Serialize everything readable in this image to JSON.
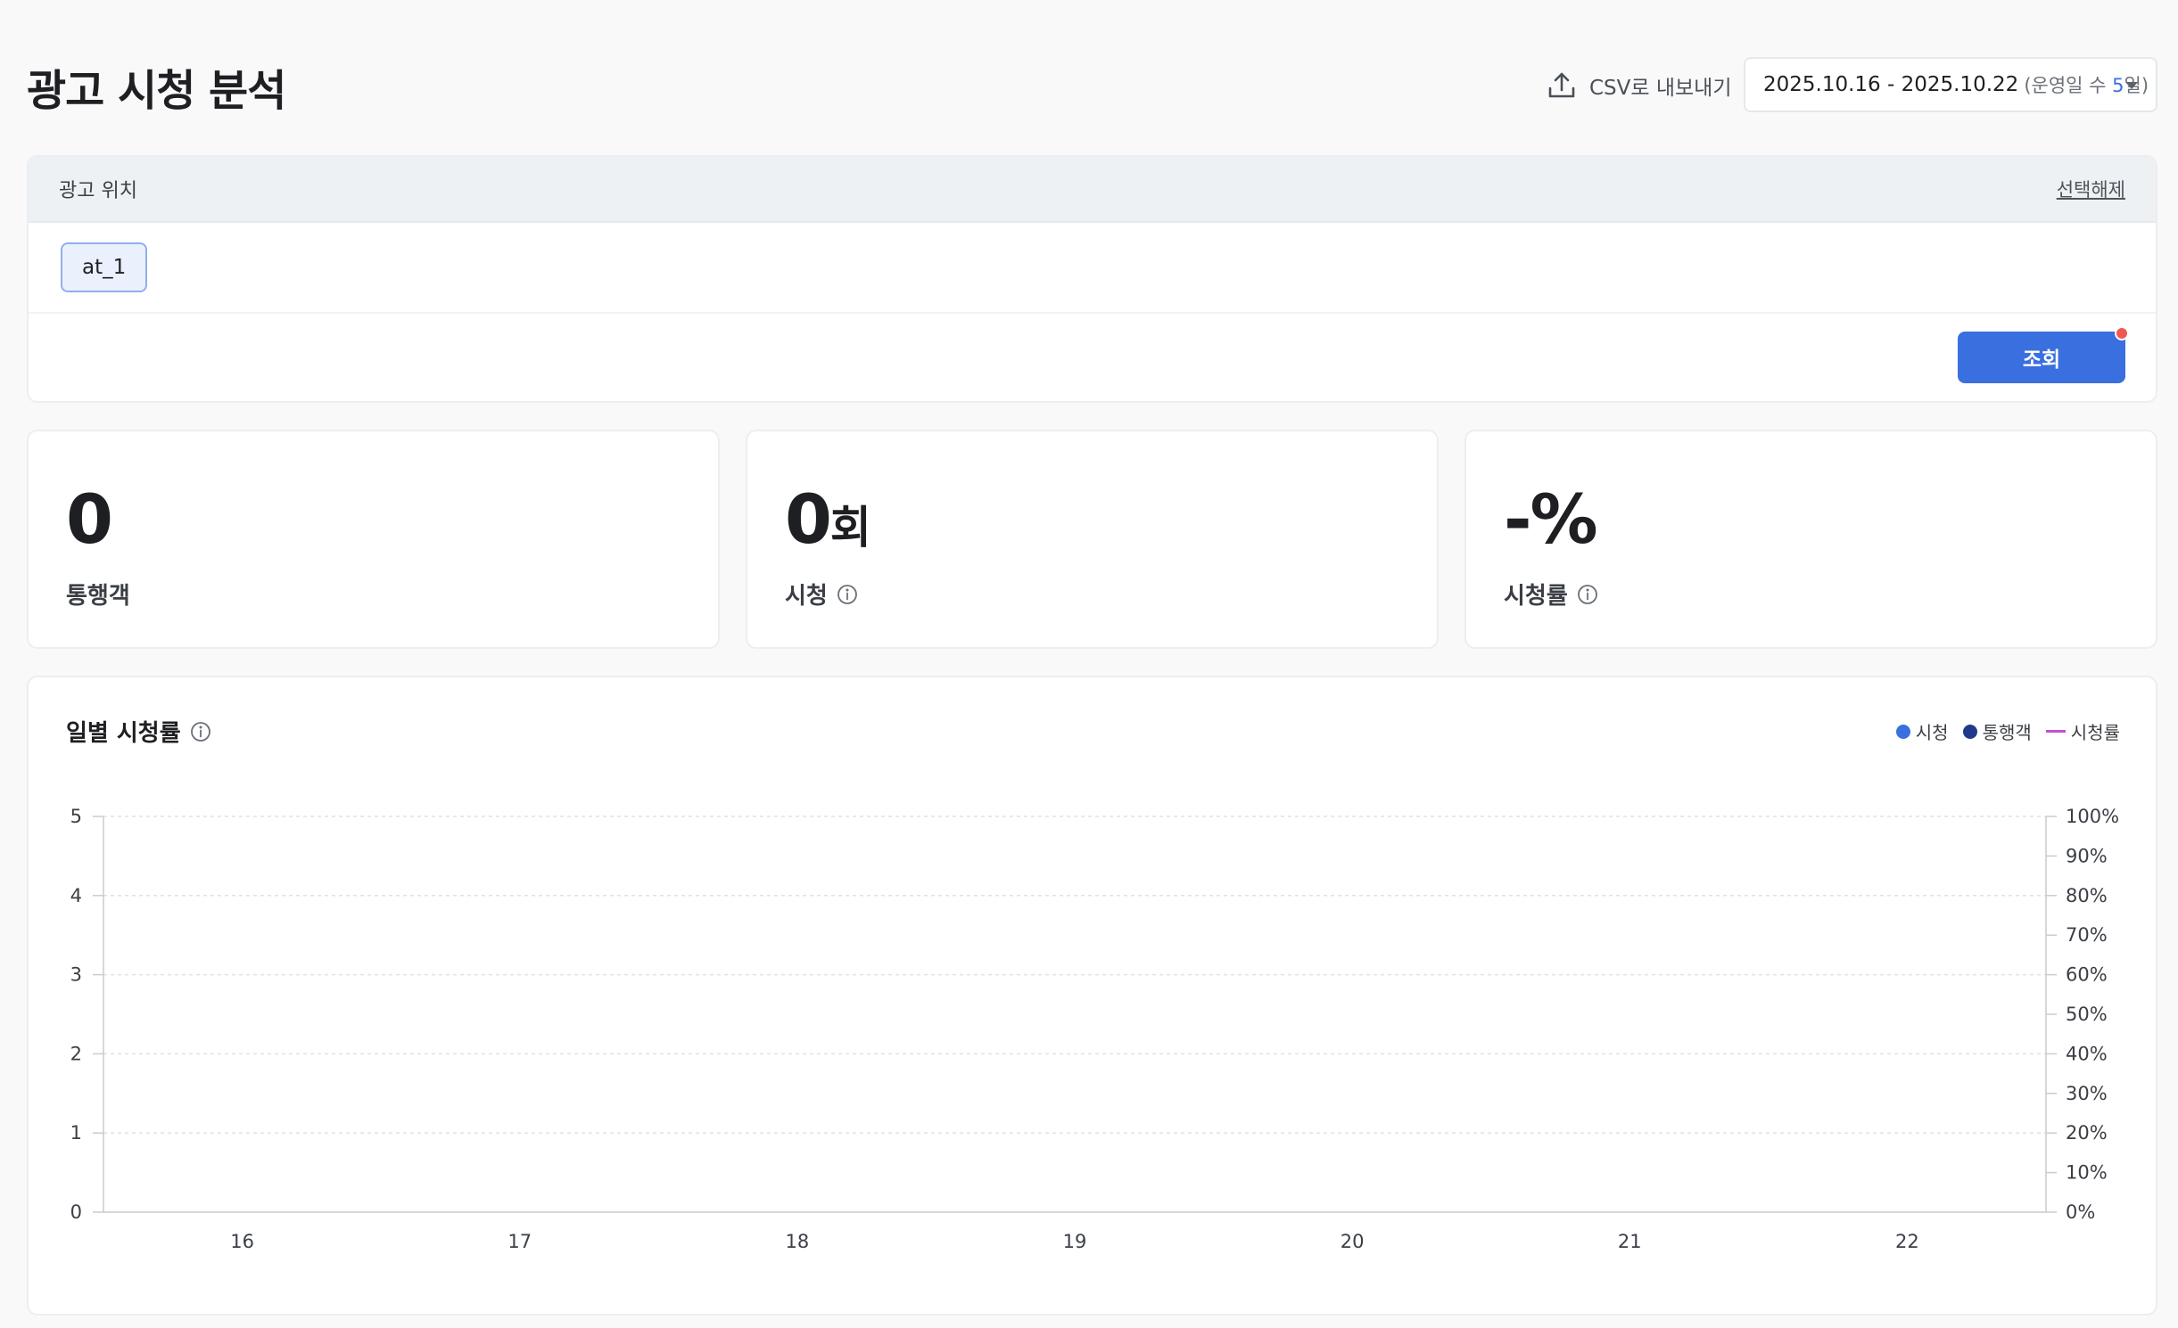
{
  "header": {
    "title": "광고 시청 분석",
    "csv_export_label": "CSV로 내보내기",
    "date_range": {
      "range": "2025.10.16 - 2025.10.22",
      "paren_open": "(운영일 수 ",
      "days": "5",
      "paren_close": "일)"
    }
  },
  "filter": {
    "label": "광고 위치",
    "clear_label": "선택해제",
    "chips": [
      "at_1"
    ],
    "query_label": "조회"
  },
  "stats": [
    {
      "value": "0",
      "unit": "",
      "label": "통행객",
      "has_info": false
    },
    {
      "value": "0",
      "unit": "회",
      "label": "시청",
      "has_info": true
    },
    {
      "value": "-%",
      "unit": "",
      "label": "시청률",
      "has_info": true
    }
  ],
  "chart": {
    "title": "일별 시청률",
    "legend": [
      {
        "name": "시청",
        "color": "#3a6fe0",
        "shape": "dot"
      },
      {
        "name": "통행객",
        "color": "#1f3a8a",
        "shape": "dot"
      },
      {
        "name": "시청률",
        "color": "#c64fd6",
        "shape": "line"
      }
    ]
  },
  "chart_data": {
    "type": "line",
    "title": "일별 시청률",
    "categories": [
      "16",
      "17",
      "18",
      "19",
      "20",
      "21",
      "22"
    ],
    "category_colors": [
      "#3b3f45",
      "#3b3f45",
      "#3a6fe0",
      "#e04b4b",
      "#3b3f45",
      "#3b3f45",
      "#3b3f45"
    ],
    "ylim": [
      0,
      5
    ],
    "y_ticks": [
      "0",
      "1",
      "2",
      "3",
      "4",
      "5"
    ],
    "y2lim": [
      0,
      100
    ],
    "y2_ticks": [
      "0%",
      "10%",
      "20%",
      "30%",
      "40%",
      "50%",
      "60%",
      "70%",
      "80%",
      "90%",
      "100%"
    ],
    "grid": true,
    "legend_position": "top-right",
    "series": [
      {
        "name": "시청",
        "axis": "left",
        "values": [
          0,
          0,
          0,
          0,
          0,
          0,
          0
        ]
      },
      {
        "name": "통행객",
        "axis": "left",
        "values": [
          0,
          0,
          0,
          0,
          0,
          0,
          0
        ]
      },
      {
        "name": "시청률",
        "axis": "right",
        "values": [
          null,
          null,
          null,
          null,
          null,
          null,
          null
        ]
      }
    ]
  }
}
